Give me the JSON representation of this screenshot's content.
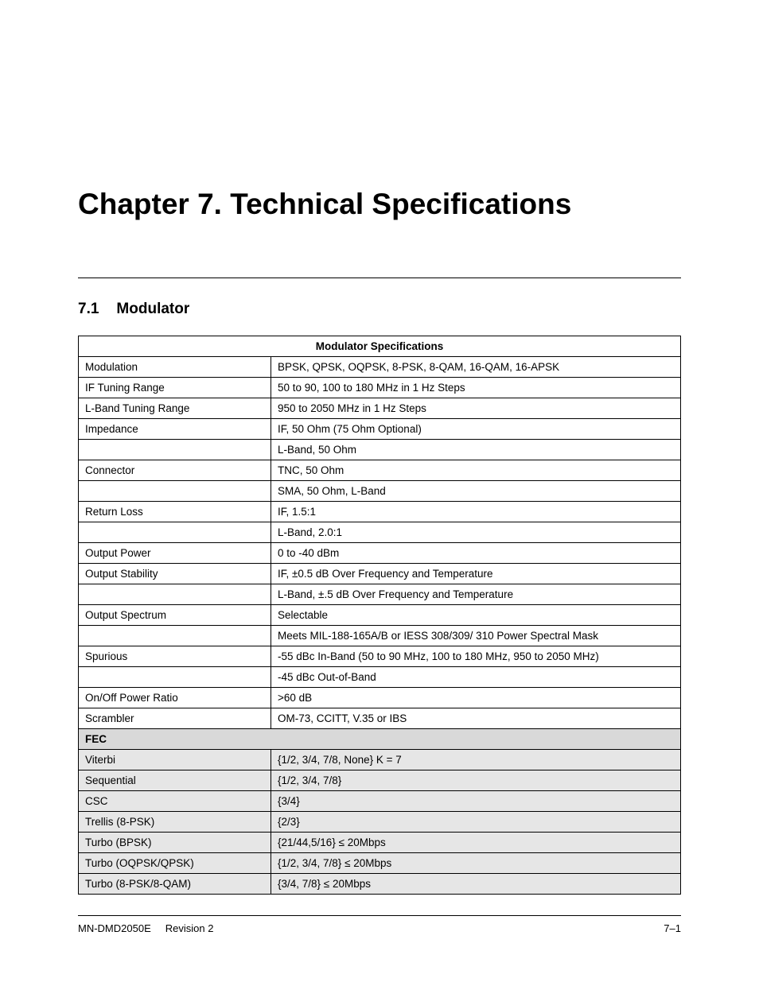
{
  "chapter": {
    "title": "Chapter 7.  Technical Specifications"
  },
  "section": {
    "number": "7.1",
    "title": "Modulator"
  },
  "table": {
    "title": "Modulator Specifications",
    "rows": [
      {
        "label": "Modulation",
        "value": "BPSK, QPSK, OQPSK, 8-PSK, 8-QAM, 16-QAM, 16-APSK"
      },
      {
        "label": "IF Tuning Range",
        "value": "50 to 90, 100 to 180 MHz in 1 Hz Steps"
      },
      {
        "label": "L-Band Tuning Range",
        "value": "950 to 2050 MHz in 1 Hz Steps"
      },
      {
        "label": "Impedance",
        "value": "IF, 50 Ohm (75 Ohm Optional)"
      },
      {
        "label": "",
        "value": "L-Band, 50 Ohm"
      },
      {
        "label": "Connector",
        "value": "TNC, 50 Ohm"
      },
      {
        "label": "",
        "value": "SMA, 50 Ohm, L-Band"
      },
      {
        "label": "Return Loss",
        "value": "IF, 1.5:1"
      },
      {
        "label": "",
        "value": "L-Band, 2.0:1"
      },
      {
        "label": "Output Power",
        "value": "0 to -40 dBm"
      },
      {
        "label": "Output Stability",
        "value": "IF, ±0.5 dB Over Frequency and Temperature"
      },
      {
        "label": "",
        "value": "L-Band, ±.5 dB Over Frequency and Temperature"
      },
      {
        "label": "Output Spectrum",
        "value": "Selectable"
      },
      {
        "label": "",
        "value": "Meets MIL-188-165A/B or IESS 308/309/ 310 Power Spectral Mask"
      },
      {
        "label": "Spurious",
        "value": "-55 dBc In-Band (50 to 90 MHz, 100 to 180 MHz, 950 to 2050 MHz)"
      },
      {
        "label": "",
        "value": "-45 dBc Out-of-Band"
      },
      {
        "label": "On/Off Power Ratio",
        "value": ">60 dB"
      },
      {
        "label": "Scrambler",
        "value": "OM-73, CCITT, V.35 or IBS"
      }
    ],
    "fec_header": "FEC",
    "fec_rows": [
      {
        "label": "Viterbi",
        "value": "{1/2, 3/4, 7/8, None}  K = 7"
      },
      {
        "label": "Sequential",
        "value": "{1/2, 3/4, 7/8}"
      },
      {
        "label": "CSC",
        "value": "{3/4}"
      },
      {
        "label": "Trellis (8-PSK)",
        "value": "{2/3}"
      },
      {
        "label": "Turbo (BPSK)",
        "value": "{21/44,5/16}  ≤ 20Mbps"
      },
      {
        "label": "Turbo (OQPSK/QPSK)",
        "value": "{1/2, 3/4, 7/8}  ≤ 20Mbps"
      },
      {
        "label": "Turbo (8-PSK/8-QAM)",
        "value": "{3/4, 7/8}  ≤ 20Mbps"
      }
    ]
  },
  "footer": {
    "doc_id": "MN-DMD2050E",
    "revision": "Revision 2",
    "page": "7–1"
  }
}
